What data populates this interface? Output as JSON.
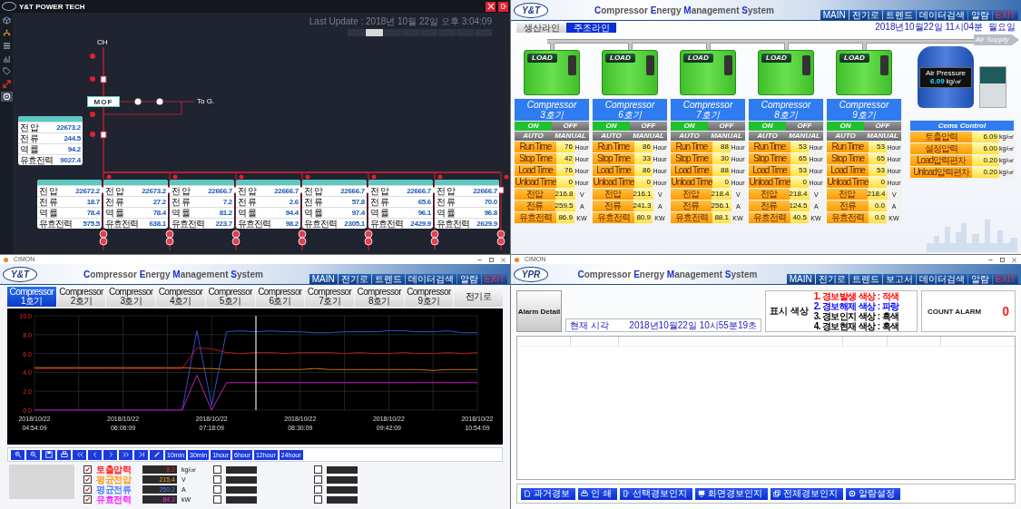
{
  "top_left": {
    "title": "Y&T POWER TECH",
    "sidebar": [
      {
        "selected": false
      },
      {
        "selected": false
      },
      {
        "selected": false
      },
      {
        "selected": false
      },
      {
        "selected": false
      },
      {
        "selected": false
      },
      {
        "selected": true
      }
    ],
    "last_update": "Last Update : 2018년 10월 22일 오후 3:04:09",
    "tabs": [
      {
        "selected": false
      },
      {
        "selected": true
      },
      {
        "selected": false
      },
      {
        "selected": false
      },
      {
        "selected": false
      },
      {
        "selected": false
      },
      {
        "selected": false
      },
      {
        "selected": false
      }
    ],
    "source_label": "CH",
    "meter_label": "MOF",
    "outgoing_label": "To G.",
    "main_panel": {
      "rows": [
        {
          "label": "전 압",
          "value": "22673.2"
        },
        {
          "label": "전 류",
          "value": "244.5"
        },
        {
          "label": "역 률",
          "value": "94.2"
        },
        {
          "label": "유효전력",
          "value": "9027.4"
        }
      ]
    },
    "feeders": [
      {
        "rows": [
          {
            "label": "전 압",
            "value": "22672.2"
          },
          {
            "label": "전 류",
            "value": "18.7"
          },
          {
            "label": "역 률",
            "value": "78.4"
          },
          {
            "label": "유효전력",
            "value": "575.5"
          }
        ]
      },
      {
        "rows": [
          {
            "label": "전 압",
            "value": "22673.2"
          },
          {
            "label": "전 류",
            "value": "27.2"
          },
          {
            "label": "역 률",
            "value": "78.4"
          },
          {
            "label": "유효전력",
            "value": "638.1"
          }
        ]
      },
      {
        "rows": [
          {
            "label": "전 압",
            "value": "22666.7"
          },
          {
            "label": "전 류",
            "value": "7.2"
          },
          {
            "label": "역 률",
            "value": "81.2"
          },
          {
            "label": "유효전력",
            "value": "223.7"
          }
        ]
      },
      {
        "rows": [
          {
            "label": "전 압",
            "value": "22666.7"
          },
          {
            "label": "전 류",
            "value": "2.6"
          },
          {
            "label": "역 률",
            "value": "94.4"
          },
          {
            "label": "유효전력",
            "value": "98.2"
          }
        ]
      },
      {
        "rows": [
          {
            "label": "전 압",
            "value": "22666.7"
          },
          {
            "label": "전 류",
            "value": "57.8"
          },
          {
            "label": "역 률",
            "value": "97.4"
          },
          {
            "label": "유효전력",
            "value": "2305.1"
          }
        ]
      },
      {
        "rows": [
          {
            "label": "전 압",
            "value": "22666.7"
          },
          {
            "label": "전 류",
            "value": "65.6"
          },
          {
            "label": "역 률",
            "value": "96.1"
          },
          {
            "label": "유효전력",
            "value": "2429.9"
          }
        ]
      },
      {
        "rows": [
          {
            "label": "전 압",
            "value": "22666.7"
          },
          {
            "label": "전 류",
            "value": "70.0"
          },
          {
            "label": "역 률",
            "value": "96.8"
          },
          {
            "label": "유효전력",
            "value": "2629.9"
          }
        ]
      }
    ]
  },
  "top_right": {
    "logo": "Y&T",
    "title": "Compressor Energy Management System",
    "nav": [
      {
        "label": "MAIN",
        "kind": "normal"
      },
      {
        "label": "전기로",
        "kind": "normal"
      },
      {
        "label": "트렌드",
        "kind": "normal"
      },
      {
        "label": "데이터검색",
        "kind": "normal"
      },
      {
        "label": "알람",
        "kind": "normal"
      },
      {
        "label": "EXIT",
        "kind": "exit"
      }
    ],
    "date": "2018년10월22일 11시04분",
    "weekday": "월요일",
    "line_tabs": [
      {
        "label": "생산라인",
        "selected": false
      },
      {
        "label": "주조라인",
        "selected": true
      }
    ],
    "tank": {
      "label": "Air Pressure",
      "value": "6.09",
      "unit": "kg/㎠"
    },
    "supply_label": "Air Supply",
    "compressors": [
      {
        "status": "LOAD",
        "name": "Compressor 3호기",
        "power": [
          {
            "label": "ON",
            "selected": true
          },
          {
            "label": "OFF",
            "selected": false
          }
        ],
        "mode": [
          "AUTO",
          "MANUAL"
        ],
        "rows": [
          {
            "label": "Run Time",
            "value": "76",
            "unit": "Hour"
          },
          {
            "label": "Stop Time",
            "value": "42",
            "unit": "Hour"
          },
          {
            "label": "Load Time",
            "value": "76",
            "unit": "Hour"
          },
          {
            "label": "Unload Time",
            "value": "0",
            "unit": "Hour"
          },
          {
            "label": "전압",
            "value": "216.8",
            "unit": "V"
          },
          {
            "label": "전류",
            "value": "259.5",
            "unit": "A"
          },
          {
            "label": "유효전력",
            "value": "86.9",
            "unit": "KW"
          }
        ]
      },
      {
        "status": "LOAD",
        "name": "Compressor 6호기",
        "power": [
          {
            "label": "ON",
            "selected": true
          },
          {
            "label": "OFF",
            "selected": false
          }
        ],
        "mode": [
          "AUTO",
          "MANUAL"
        ],
        "rows": [
          {
            "label": "Run Time",
            "value": "86",
            "unit": "Hour"
          },
          {
            "label": "Stop Time",
            "value": "33",
            "unit": "Hour"
          },
          {
            "label": "Load Time",
            "value": "86",
            "unit": "Hour"
          },
          {
            "label": "Unload Time",
            "value": "0",
            "unit": "Hour"
          },
          {
            "label": "전압",
            "value": "216.1",
            "unit": "V"
          },
          {
            "label": "전류",
            "value": "241.3",
            "unit": "A"
          },
          {
            "label": "유효전력",
            "value": "80.9",
            "unit": "KW"
          }
        ]
      },
      {
        "status": "LOAD",
        "name": "Compressor 7호기",
        "power": [
          {
            "label": "ON",
            "selected": true
          },
          {
            "label": "OFF",
            "selected": false
          }
        ],
        "mode": [
          "AUTO",
          "MANUAL"
        ],
        "rows": [
          {
            "label": "Run Time",
            "value": "88",
            "unit": "Hour"
          },
          {
            "label": "Stop Time",
            "value": "30",
            "unit": "Hour"
          },
          {
            "label": "Load Time",
            "value": "88",
            "unit": "Hour"
          },
          {
            "label": "Unload Time",
            "value": "0",
            "unit": "Hour"
          },
          {
            "label": "전압",
            "value": "218.4",
            "unit": "V"
          },
          {
            "label": "전류",
            "value": "256.1",
            "unit": "A"
          },
          {
            "label": "유효전력",
            "value": "88.1",
            "unit": "KW"
          }
        ]
      },
      {
        "status": "LOAD",
        "name": "Compressor 8호기",
        "power": [
          {
            "label": "ON",
            "selected": true
          },
          {
            "label": "OFF",
            "selected": false
          }
        ],
        "mode": [
          "AUTO",
          "MANUAL"
        ],
        "rows": [
          {
            "label": "Run Time",
            "value": "53",
            "unit": "Hour"
          },
          {
            "label": "Stop Time",
            "value": "65",
            "unit": "Hour"
          },
          {
            "label": "Load Time",
            "value": "53",
            "unit": "Hour"
          },
          {
            "label": "Unload Time",
            "value": "0",
            "unit": "Hour"
          },
          {
            "label": "전압",
            "value": "218.4",
            "unit": "V"
          },
          {
            "label": "전류",
            "value": "124.5",
            "unit": "A"
          },
          {
            "label": "유효전력",
            "value": "40.5",
            "unit": "KW"
          }
        ]
      },
      {
        "status": "LOAD",
        "name": "Compressor 9호기",
        "power": [
          {
            "label": "ON",
            "selected": true
          },
          {
            "label": "OFF",
            "selected": false
          }
        ],
        "mode": [
          "AUTO",
          "MANUAL"
        ],
        "rows": [
          {
            "label": "Run Time",
            "value": "53",
            "unit": "Hour"
          },
          {
            "label": "Stop Time",
            "value": "65",
            "unit": "Hour"
          },
          {
            "label": "Load Time",
            "value": "53",
            "unit": "Hour"
          },
          {
            "label": "Unload Time",
            "value": "0",
            "unit": "Hour"
          },
          {
            "label": "전압",
            "value": "218.4",
            "unit": "V"
          },
          {
            "label": "전류",
            "value": "0.0",
            "unit": "A"
          },
          {
            "label": "유효전력",
            "value": "0.0",
            "unit": "KW"
          }
        ]
      }
    ],
    "cems": {
      "title": "Cems Control",
      "rows": [
        {
          "label": "토출압력",
          "value": "6.09",
          "unit": "kg/㎠"
        },
        {
          "label": "설정압력",
          "value": "6.00",
          "unit": "kg/㎠"
        },
        {
          "label": "Load압력편차",
          "value": "0.20",
          "unit": "kg/㎠"
        },
        {
          "label": "Unload압력편차",
          "value": "0.20",
          "unit": "kg/㎠"
        }
      ]
    }
  },
  "bottom_left": {
    "window_title": "CIMON",
    "logo": "Y&T",
    "title": "Compressor Energy Management System",
    "nav": [
      {
        "label": "MAIN",
        "kind": "normal"
      },
      {
        "label": "전기로",
        "kind": "normal"
      },
      {
        "label": "트렌드",
        "kind": "normal"
      },
      {
        "label": "데이터검색",
        "kind": "normal"
      },
      {
        "label": "알람",
        "kind": "normal"
      },
      {
        "label": "EXIT",
        "kind": "exit"
      }
    ],
    "tabs": [
      {
        "label": "Compressor 1호기",
        "selected": true
      },
      {
        "label": "Compressor 2호기",
        "selected": false
      },
      {
        "label": "Compressor 3호기",
        "selected": false
      },
      {
        "label": "Compressor 4호기",
        "selected": false
      },
      {
        "label": "Compressor 5호기",
        "selected": false
      },
      {
        "label": "Compressor 6호기",
        "selected": false
      },
      {
        "label": "Compressor 7호기",
        "selected": false
      },
      {
        "label": "Compressor 8호기",
        "selected": false
      },
      {
        "label": "Compressor 9호기",
        "selected": false
      },
      {
        "label": "전기로",
        "selected": false
      }
    ],
    "chart_data": {
      "type": "line",
      "categories": [
        "2018/10/22 04:54:09",
        null,
        null,
        null,
        null,
        null,
        "2018/10/22 06:06:09",
        null,
        null,
        null,
        null,
        null,
        "2018/10/22 07:18:09",
        null,
        null,
        null,
        null,
        null,
        "2018/10/22 08:30:09",
        null,
        null,
        null,
        null,
        null,
        "2018/10/22 09:42:09",
        null,
        null,
        null,
        null,
        null,
        "2018/10/22 10:54:09"
      ],
      "ylim": [
        0,
        10
      ],
      "grid": true,
      "yticks": [
        {
          "value": 0,
          "label": "0.0"
        },
        {
          "value": 2,
          "label": "2.0"
        },
        {
          "value": 4,
          "label": "4.0"
        },
        {
          "value": 6,
          "label": "6.0"
        },
        {
          "value": 8,
          "label": "8.0"
        },
        {
          "value": 10,
          "label": "10.0"
        }
      ],
      "series": [
        {
          "color": "#2f4fd0",
          "values": [
            null,
            null,
            null,
            null,
            null,
            null,
            null,
            null,
            null,
            null,
            0,
            8.4,
            0.5,
            8.3,
            8.4,
            8.3,
            8.4,
            8.3,
            8.3,
            8.2,
            8.2,
            8.3,
            8.3,
            8.3,
            8.4,
            8.4,
            8.3,
            8.3,
            8.4,
            8.2,
            8.2
          ]
        },
        {
          "color": "#c01020",
          "values": [
            4.4,
            4.4,
            4.4,
            4.4,
            4.4,
            4.4,
            4.4,
            4.4,
            4.4,
            4.4,
            4.4,
            6.6,
            6.5,
            6.1,
            6.0,
            6.1,
            6.1,
            6.0,
            6.1,
            6.1,
            6.1,
            6.0,
            6.1,
            6.0,
            6.0,
            6.1,
            6.0,
            6.0,
            6.1,
            6.0,
            6.1
          ]
        },
        {
          "color": "#c87010",
          "values": [
            4.5,
            4.5,
            4.5,
            4.5,
            4.5,
            4.5,
            4.5,
            4.5,
            4.5,
            4.5,
            4.5,
            4.4,
            4.4,
            4.3,
            4.3,
            4.3,
            4.3,
            4.3,
            4.3,
            4.4,
            4.3,
            4.3,
            4.3,
            4.3,
            4.3,
            4.3,
            4.3,
            4.2,
            4.3,
            4.3,
            4.3
          ]
        },
        {
          "color": "#c020c0",
          "values": [
            0,
            0,
            0,
            0,
            0,
            0,
            0,
            0,
            0,
            0,
            0,
            3.7,
            0,
            2.9,
            2.9,
            2.9,
            2.9,
            2.9,
            2.9,
            2.9,
            2.9,
            2.9,
            2.9,
            2.9,
            2.9,
            2.9,
            2.9,
            2.9,
            2.9,
            2.9,
            2.9
          ]
        }
      ]
    },
    "tools": [
      {
        "kind": "icon"
      },
      {
        "kind": "icon"
      },
      {
        "kind": "icon"
      },
      {
        "kind": "icon"
      },
      {
        "kind": "icon"
      },
      {
        "kind": "icon"
      },
      {
        "kind": "icon"
      },
      {
        "kind": "icon"
      },
      {
        "kind": "icon"
      },
      {
        "kind": "icon"
      },
      {
        "kind": "range",
        "label": "10min"
      },
      {
        "kind": "range",
        "label": "30min"
      },
      {
        "kind": "range",
        "label": "1hour"
      },
      {
        "kind": "range",
        "label": "6hour"
      },
      {
        "kind": "range",
        "label": "12hour"
      },
      {
        "kind": "range",
        "label": "24hour"
      }
    ],
    "legend": [
      {
        "label": "토출압력",
        "color": "#ff2020",
        "checked": true,
        "value": "6.2",
        "unit": "kg/㎠",
        "extra": [
          {
            "checked": false
          },
          {
            "checked": false
          }
        ]
      },
      {
        "label": "평균전압",
        "color": "#ff9a10",
        "checked": true,
        "value": "215.4",
        "unit": "V",
        "extra": [
          {
            "checked": false
          },
          {
            "checked": false
          }
        ]
      },
      {
        "label": "평균전류",
        "color": "#4f7fff",
        "checked": true,
        "value": "250.2",
        "unit": "A",
        "extra": [
          {
            "checked": false
          },
          {
            "checked": false
          }
        ]
      },
      {
        "label": "유효전력",
        "color": "#ff20ff",
        "checked": true,
        "value": "84.3",
        "unit": "kW",
        "extra": [
          {
            "checked": false
          },
          {
            "checked": false
          }
        ]
      }
    ]
  },
  "bottom_right": {
    "window_title": "CIMON",
    "logo": "YPR",
    "title": "Compressor Energy Management System",
    "nav": [
      {
        "label": "MAIN",
        "kind": "normal"
      },
      {
        "label": "전기로",
        "kind": "normal"
      },
      {
        "label": "트렌드",
        "kind": "normal"
      },
      {
        "label": "보고서",
        "kind": "normal"
      },
      {
        "label": "데이터검색",
        "kind": "normal"
      },
      {
        "label": "알람",
        "kind": "normal"
      },
      {
        "label": "EXIT",
        "kind": "exit"
      }
    ],
    "alarm_detail": "Alarm Detail",
    "time_label": "현재 시각",
    "time": "2018년10월22일 10시55분19초",
    "legend_title": "표시 색상",
    "legend": [
      {
        "text": "1. 경보발생 색상 : 적색",
        "color": "#ff0000"
      },
      {
        "text": "2. 경보해제 색상 : 파랑",
        "color": "#0000ff"
      },
      {
        "text": "3. 경보인지 색상 : 흑색",
        "color": "#000000"
      },
      {
        "text": "4. 경보현재 색상 : 흑색",
        "color": "#000000"
      }
    ],
    "count_label": "COUNT ALARM",
    "count": "0",
    "buttons": [
      {
        "label": "과거경보"
      },
      {
        "label": "인 쇄"
      },
      {
        "label": "선택경보인지"
      },
      {
        "label": "화면경보인지"
      },
      {
        "label": "전체경보인지"
      },
      {
        "label": "알람설정"
      }
    ]
  }
}
